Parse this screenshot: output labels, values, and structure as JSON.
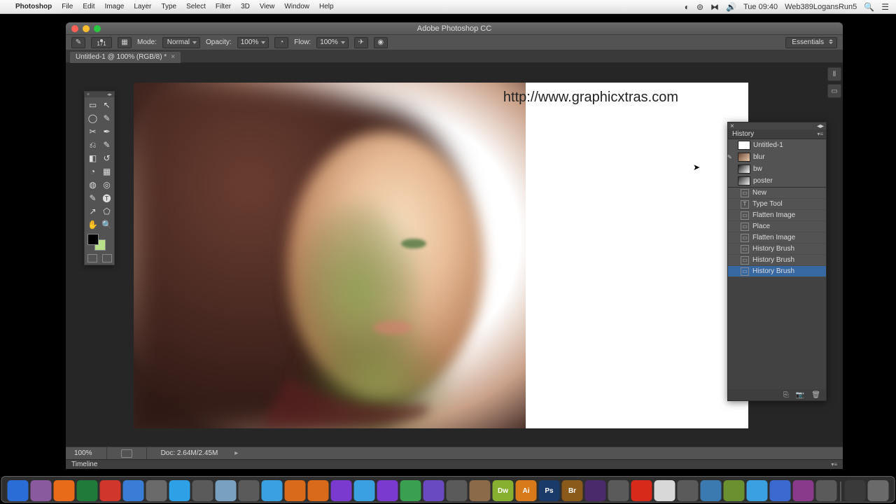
{
  "menubar": {
    "app": "Photoshop",
    "items": [
      "File",
      "Edit",
      "Image",
      "Layer",
      "Type",
      "Select",
      "Filter",
      "3D",
      "View",
      "Window",
      "Help"
    ],
    "clock": "Tue 09:40",
    "user": "Web389LogansRun5"
  },
  "window": {
    "title": "Adobe Photoshop CC"
  },
  "options": {
    "brush_size": "171",
    "mode_label": "Mode:",
    "mode_value": "Normal",
    "opacity_label": "Opacity:",
    "opacity_value": "100%",
    "flow_label": "Flow:",
    "flow_value": "100%",
    "workspace": "Essentials"
  },
  "document": {
    "tab": "Untitled-1 @ 100% (RGB/8) *"
  },
  "canvas": {
    "watermark": "http://www.graphicxtras.com"
  },
  "history": {
    "title": "History",
    "snapshots": [
      {
        "label": "Untitled-1",
        "thumb": "a"
      },
      {
        "label": "blur",
        "thumb": "b",
        "source": true
      },
      {
        "label": "bw",
        "thumb": "c"
      },
      {
        "label": "poster",
        "thumb": "d"
      }
    ],
    "states": [
      {
        "label": "New",
        "icon": "▭"
      },
      {
        "label": "Type Tool",
        "icon": "T"
      },
      {
        "label": "Flatten Image",
        "icon": "▭"
      },
      {
        "label": "Place",
        "icon": "▭"
      },
      {
        "label": "Flatten Image",
        "icon": "▭"
      },
      {
        "label": "History Brush",
        "icon": "▭"
      },
      {
        "label": "History Brush",
        "icon": "▭"
      },
      {
        "label": "History Brush",
        "icon": "▭",
        "selected": true
      }
    ]
  },
  "status": {
    "zoom": "100%",
    "doc": "Doc: 2.64M/2.45M"
  },
  "timeline": {
    "label": "Timeline"
  },
  "tools": [
    "▭",
    "↖",
    "◯",
    "✎",
    "✂",
    "✒",
    "⎌",
    "✎",
    "◧",
    "↺",
    "◔",
    "▦",
    "◍",
    "◎",
    "✎",
    "🅣",
    "↗",
    "⬠",
    "✋",
    "🔍"
  ],
  "dock_apps": [
    {
      "c": "#2b6dd6"
    },
    {
      "c": "#8a5a9e"
    },
    {
      "c": "#e86b1a"
    },
    {
      "c": "#207a3a"
    },
    {
      "c": "#d1362a"
    },
    {
      "c": "#3a7dd6"
    },
    {
      "c": "#6a6a6a"
    },
    {
      "c": "#2ea0e6"
    },
    {
      "c": "#5a5a5a"
    },
    {
      "c": "#7aa0c0"
    },
    {
      "c": "#5a5a5a"
    },
    {
      "c": "#3aa0e0"
    },
    {
      "c": "#d86a1a"
    },
    {
      "c": "#d86a1a"
    },
    {
      "c": "#7a3ad0"
    },
    {
      "c": "#3aa0e0"
    },
    {
      "c": "#7a3ad0"
    },
    {
      "c": "#3aa050"
    },
    {
      "c": "#6a4ac0"
    },
    {
      "c": "#5a5a5a"
    },
    {
      "c": "#8b6a4a"
    },
    {
      "c": "#88b030",
      "t": "Dw"
    },
    {
      "c": "#d87a1a",
      "t": "Ai"
    },
    {
      "c": "#1a3a6a",
      "t": "Ps"
    },
    {
      "c": "#8a5a1a",
      "t": "Br"
    },
    {
      "c": "#4a2a6a"
    },
    {
      "c": "#5a5a5a"
    },
    {
      "c": "#d82a1a"
    },
    {
      "c": "#d8d8d8"
    },
    {
      "c": "#5a5a5a"
    },
    {
      "c": "#3a7ab0"
    },
    {
      "c": "#6a9030"
    },
    {
      "c": "#3aa0e0"
    },
    {
      "c": "#3a6ad0"
    },
    {
      "c": "#8a3a8a"
    },
    {
      "c": "#5a5a5a"
    },
    {
      "c": "#3a3a3a"
    },
    {
      "c": "#6a6a6a"
    }
  ]
}
